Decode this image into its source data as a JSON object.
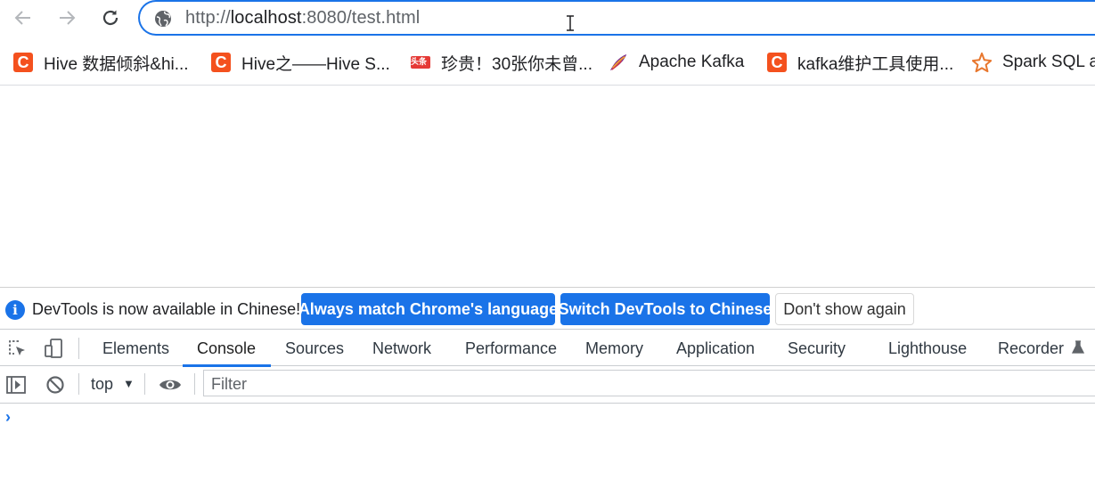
{
  "browser": {
    "url_prefix": "http://",
    "url_host": "localhost",
    "url_rest": ":8080/test.html",
    "accent_color": "#1a73e8"
  },
  "bookmarks": [
    {
      "label": "Hive 数据倾斜&hi...",
      "icon": "csdn-c-icon"
    },
    {
      "label": "Hive之——Hive S...",
      "icon": "csdn-c-icon"
    },
    {
      "label": "珍贵！30张你未曾...",
      "icon": "toutiao-icon",
      "icon_text": "头条"
    },
    {
      "label": "Apache Kafka",
      "icon": "kafka-feather-icon"
    },
    {
      "label": "kafka维护工具使用...",
      "icon": "csdn-c-icon"
    },
    {
      "label": "Spark SQL a",
      "icon": "spark-star-icon"
    }
  ],
  "devtools": {
    "infobar": {
      "message": "DevTools is now available in Chinese!",
      "btn_match": "Always match Chrome's language",
      "btn_switch": "Switch DevTools to Chinese",
      "btn_dismiss": "Don't show again"
    },
    "tabs": [
      "Elements",
      "Console",
      "Sources",
      "Network",
      "Performance",
      "Memory",
      "Application",
      "Security",
      "Lighthouse",
      "Recorder"
    ],
    "active_tab": "Console",
    "console": {
      "context": "top",
      "filter_placeholder": "Filter",
      "prompt": "›"
    }
  }
}
